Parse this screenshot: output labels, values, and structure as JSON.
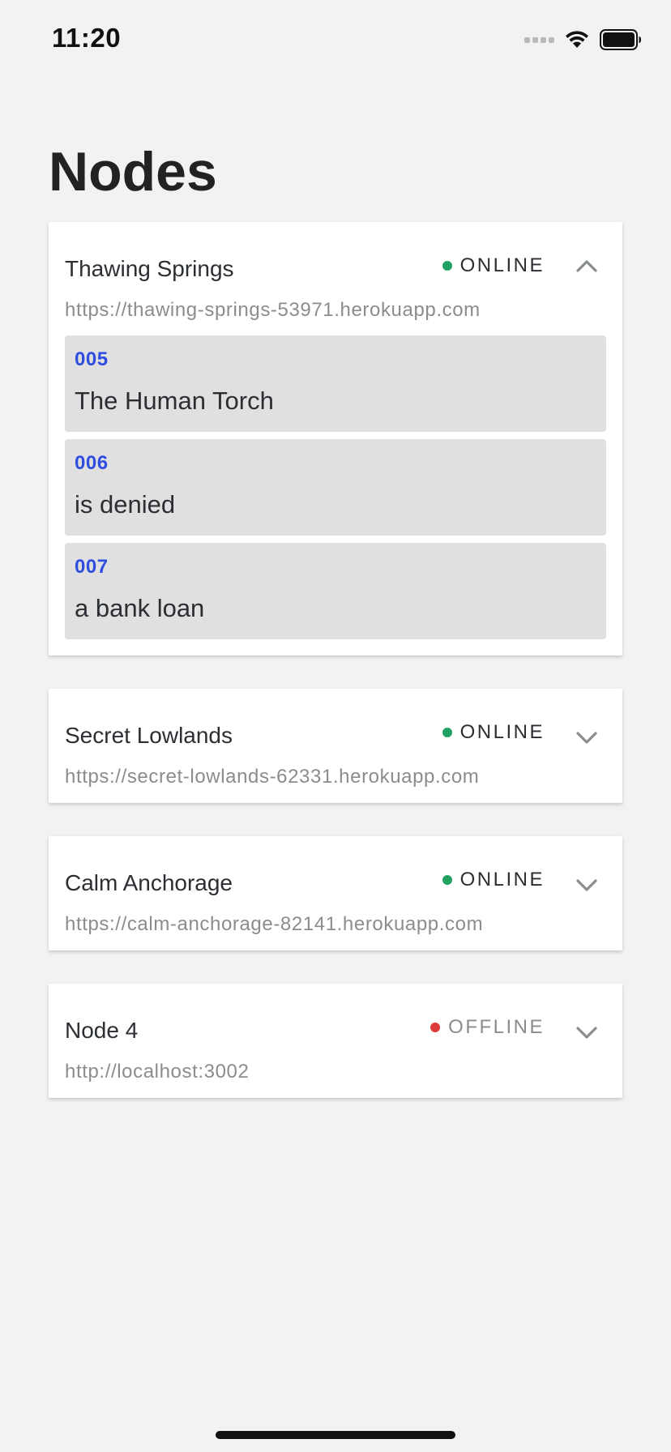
{
  "status_bar": {
    "time": "11:20"
  },
  "page": {
    "title": "Nodes"
  },
  "colors": {
    "online": "#20a162",
    "offline": "#de3b3b",
    "online_text": "#2b2f33",
    "offline_text": "#8a8d90",
    "link_blue": "#2f4de0"
  },
  "nodes": [
    {
      "name": "Thawing Springs",
      "url": "https://thawing-springs-53971.herokuapp.com",
      "status": "ONLINE",
      "expanded": true,
      "chevron_icon": "chevron-up-icon",
      "items": [
        {
          "id": "005",
          "text": "The Human Torch"
        },
        {
          "id": "006",
          "text": "is denied"
        },
        {
          "id": "007",
          "text": "a bank loan"
        }
      ]
    },
    {
      "name": "Secret Lowlands",
      "url": "https://secret-lowlands-62331.herokuapp.com",
      "status": "ONLINE",
      "expanded": false,
      "chevron_icon": "chevron-down-icon"
    },
    {
      "name": "Calm Anchorage",
      "url": "https://calm-anchorage-82141.herokuapp.com",
      "status": "ONLINE",
      "expanded": false,
      "chevron_icon": "chevron-down-icon"
    },
    {
      "name": "Node 4",
      "url": "http://localhost:3002",
      "status": "OFFLINE",
      "expanded": false,
      "chevron_icon": "chevron-down-icon"
    }
  ]
}
